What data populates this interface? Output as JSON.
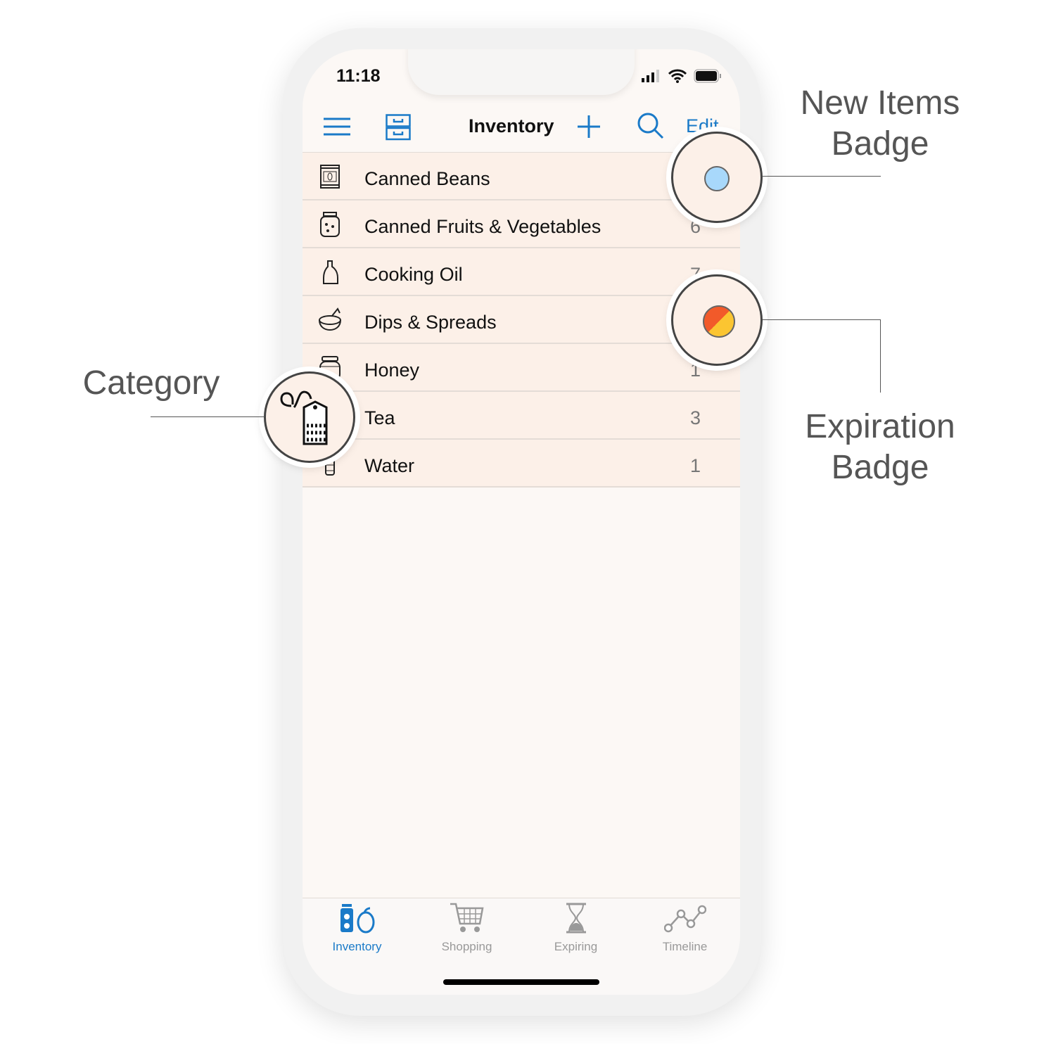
{
  "status_bar": {
    "time": "11:18"
  },
  "nav": {
    "title": "Inventory",
    "edit_label": "Edit",
    "icons": [
      "menu-icon",
      "drawers-icon",
      "plus-icon",
      "search-icon"
    ]
  },
  "categories": [
    {
      "label": "Canned Beans",
      "count": "",
      "icon": "can-icon"
    },
    {
      "label": "Canned Fruits & Vegetables",
      "count": "6",
      "icon": "jar-icon"
    },
    {
      "label": "Cooking Oil",
      "count": "7",
      "icon": "oil-bottle-icon"
    },
    {
      "label": "Dips & Spreads",
      "count": "",
      "icon": "bowl-icon"
    },
    {
      "label": "Honey",
      "count": "1",
      "icon": "honey-jar-icon"
    },
    {
      "label": "Tea",
      "count": "3",
      "icon": "tea-bag-icon"
    },
    {
      "label": "Water",
      "count": "1",
      "icon": "water-bottle-icon"
    }
  ],
  "tabs": [
    {
      "label": "Inventory",
      "icon": "inventory-icon",
      "active": true
    },
    {
      "label": "Shopping",
      "icon": "cart-icon"
    },
    {
      "label": "Expiring",
      "icon": "hourglass-icon"
    },
    {
      "label": "Timeline",
      "icon": "timeline-icon"
    }
  ],
  "callouts": {
    "new_items": "New Items Badge",
    "expiration": "Expiration Badge",
    "category": "Category"
  },
  "colors": {
    "accent": "#1a7ac8",
    "row_bg": "#fcf0e8",
    "new_badge": "#a8d8fb",
    "expiration_badge_a": "#f25a2a",
    "expiration_badge_b": "#fbc531"
  }
}
